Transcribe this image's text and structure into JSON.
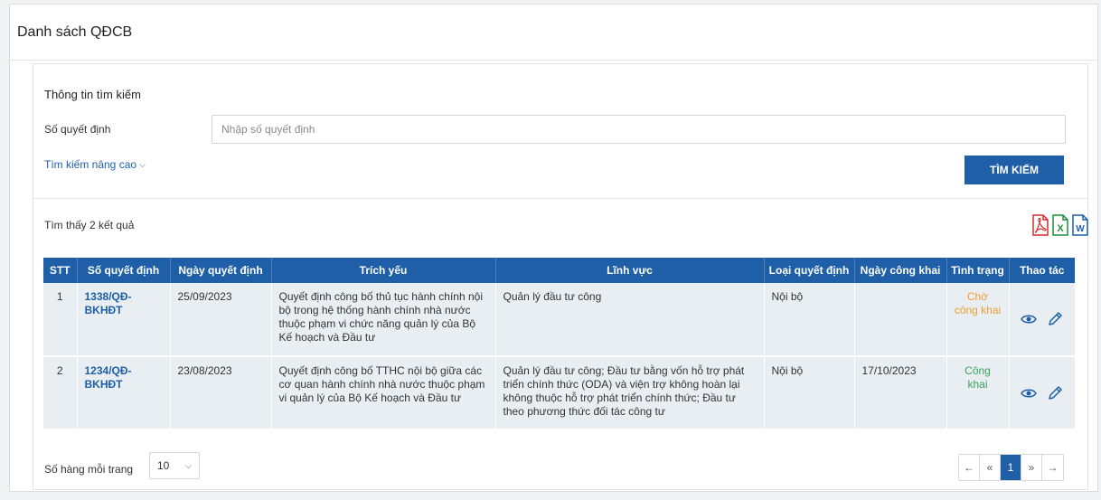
{
  "page": {
    "title": "Danh sách QĐCB"
  },
  "search": {
    "title": "Thông tin tìm kiếm",
    "decision_label": "Số quyết định",
    "decision_placeholder": "Nhập số quyết định",
    "decision_value": "",
    "advanced_label": "Tìm kiếm nâng cao",
    "submit_label": "TÌM KIẾM"
  },
  "results": {
    "count_text": "Tìm thấy 2 kết quả",
    "export_icons": [
      "pdf-icon",
      "excel-icon",
      "word-icon"
    ]
  },
  "table": {
    "headers": {
      "stt": "STT",
      "number": "Số quyết định",
      "date": "Ngày quyết định",
      "summary": "Trích yếu",
      "field": "Lĩnh vực",
      "type": "Loại quyết định",
      "public_date": "Ngày công khai",
      "status": "Tình trạng",
      "actions": "Thao tác"
    },
    "rows": [
      {
        "stt": "1",
        "number": "1338/QĐ-BKHĐT",
        "date": "25/09/2023",
        "summary": "Quyết định công bố thủ tục hành chính nội bộ trong hệ thống hành chính nhà nước thuộc phạm vi chức năng quản lý của Bộ Kế hoạch và Đầu tư",
        "field": "Quản lý đầu tư công",
        "type": "Nội bộ",
        "public_date": "",
        "status": "Chờ công khai"
      },
      {
        "stt": "2",
        "number": "1234/QĐ-BKHĐT",
        "date": "23/08/2023",
        "summary": "Quyết định công bố TTHC nội bộ giữa các cơ quan hành chính nhà nước thuộc phạm vi quản lý của Bộ Kế hoạch và Đầu tư",
        "field": "Quản lý đầu tư công; Đầu tư bằng vốn hỗ trợ phát triển chính thức (ODA) và viện trợ không hoàn lại không thuộc hỗ trợ phát triển chính thức; Đầu tư theo phương thức đối tác công tư",
        "type": "Nội bộ",
        "public_date": "17/10/2023",
        "status": "Công khai"
      }
    ],
    "action_icons": [
      "eye-icon",
      "pencil-icon"
    ]
  },
  "footer": {
    "rows_per_page_label": "Số hàng mỗi trang",
    "rows_per_page_value": "10",
    "pager": {
      "first": "←",
      "prev": "«",
      "current": "1",
      "next": "»",
      "last": "→"
    }
  },
  "colors": {
    "primary": "#1f5fa8",
    "status_pending": "#f0a030",
    "status_public": "#3aa35a",
    "row_bg": "#e9eef3"
  }
}
